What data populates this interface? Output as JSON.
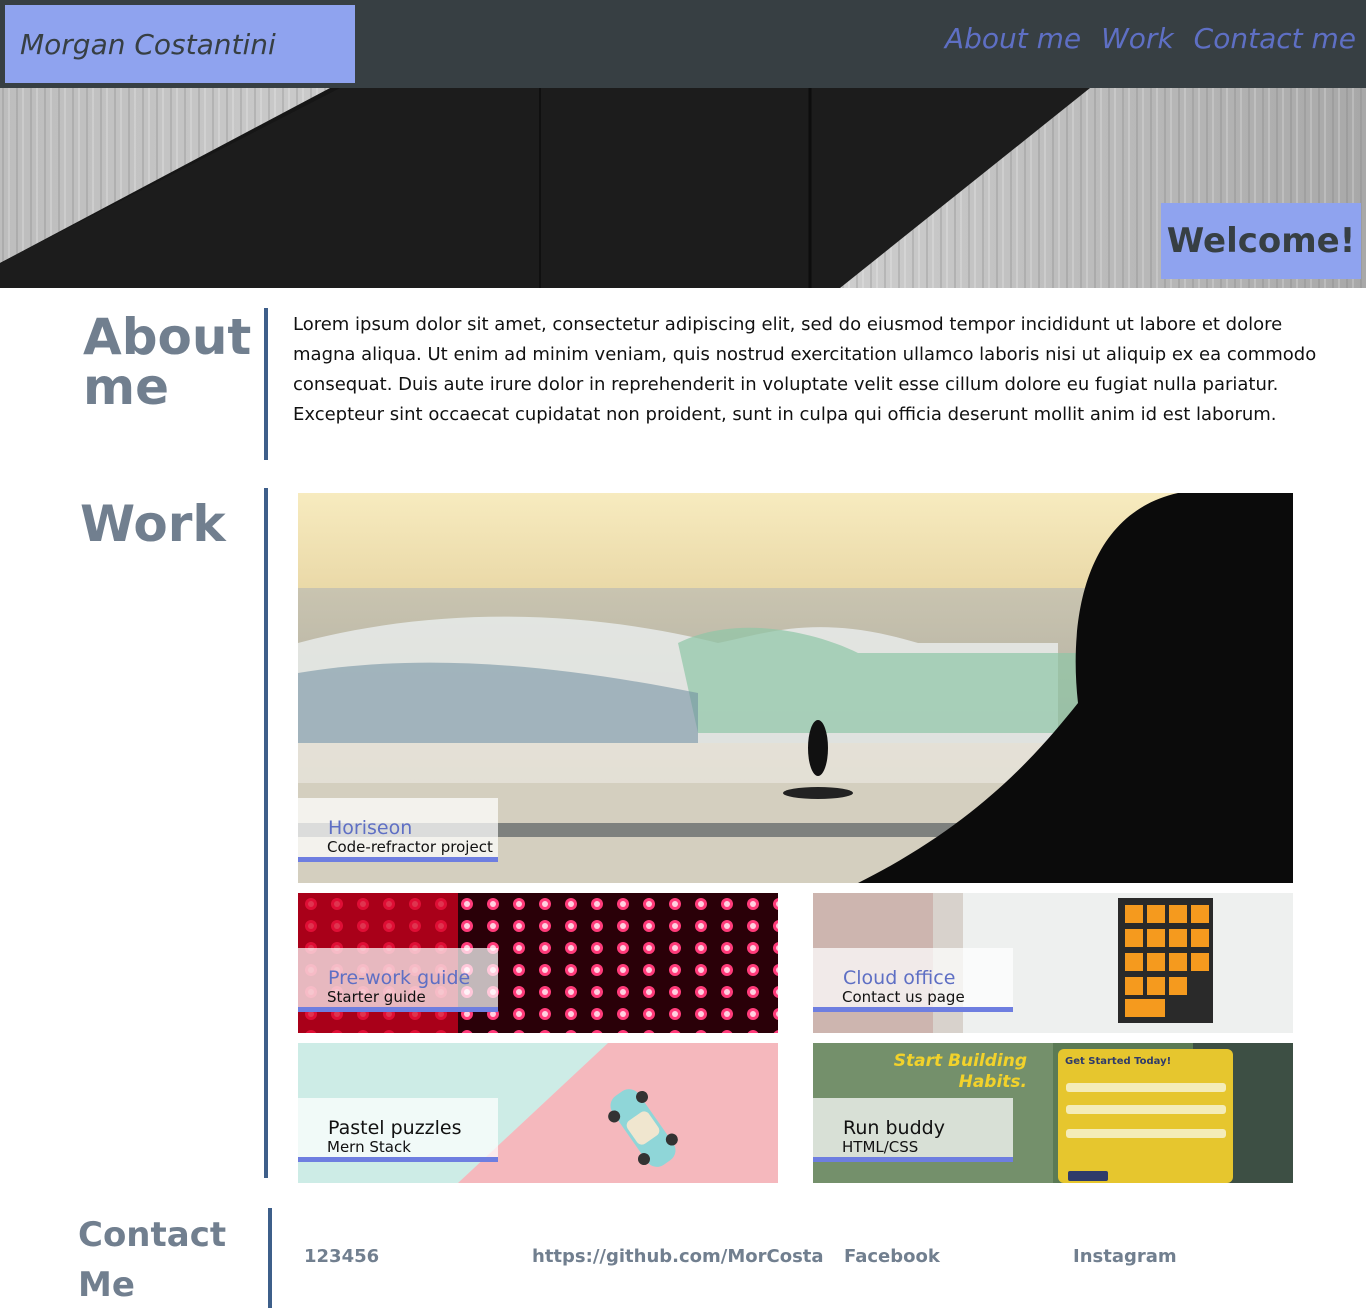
{
  "header": {
    "brand": "Morgan Costantini",
    "nav": [
      "About me",
      "Work",
      "Contact me"
    ]
  },
  "hero": {
    "welcome": "Welcome!"
  },
  "about": {
    "title": "About me",
    "text": "Lorem ipsum dolor sit amet, consectetur adipiscing elit, sed do eiusmod tempor incididunt ut labore et dolore magna aliqua. Ut enim ad minim veniam, quis nostrud exercitation ullamco laboris nisi ut aliquip ex ea commodo consequat. Duis aute irure dolor in reprehenderit in voluptate velit esse cillum dolore eu fugiat nulla pariatur. Excepteur sint occaecat cupidatat non proident, sunt in culpa qui officia deserunt mollit anim id est laborum."
  },
  "work": {
    "title": "Work",
    "projects": [
      {
        "title": "Horiseon",
        "subtitle": "Code-refractor project"
      },
      {
        "title": "Pre-work guide",
        "subtitle": "Starter guide"
      },
      {
        "title": "Cloud office",
        "subtitle": "Contact us page"
      },
      {
        "title": "Pastel puzzles",
        "subtitle": "Mern Stack"
      },
      {
        "title": "Run buddy",
        "subtitle": "HTML/CSS"
      }
    ],
    "runbuddy_image_text": {
      "headline_1": "Start Building",
      "headline_2": "Habits.",
      "form_title": "Get Started Today!"
    }
  },
  "contact": {
    "title": "Contact Me",
    "links": [
      "123456",
      "https://github.com/MorCosta",
      "Facebook",
      "Instagram"
    ]
  },
  "colors": {
    "header_bg": "#373f43",
    "accent": "#8fa3ef",
    "nav_link": "#5e6fc4",
    "divider": "#3e5f8a",
    "heading_gray": "#717f8f"
  }
}
